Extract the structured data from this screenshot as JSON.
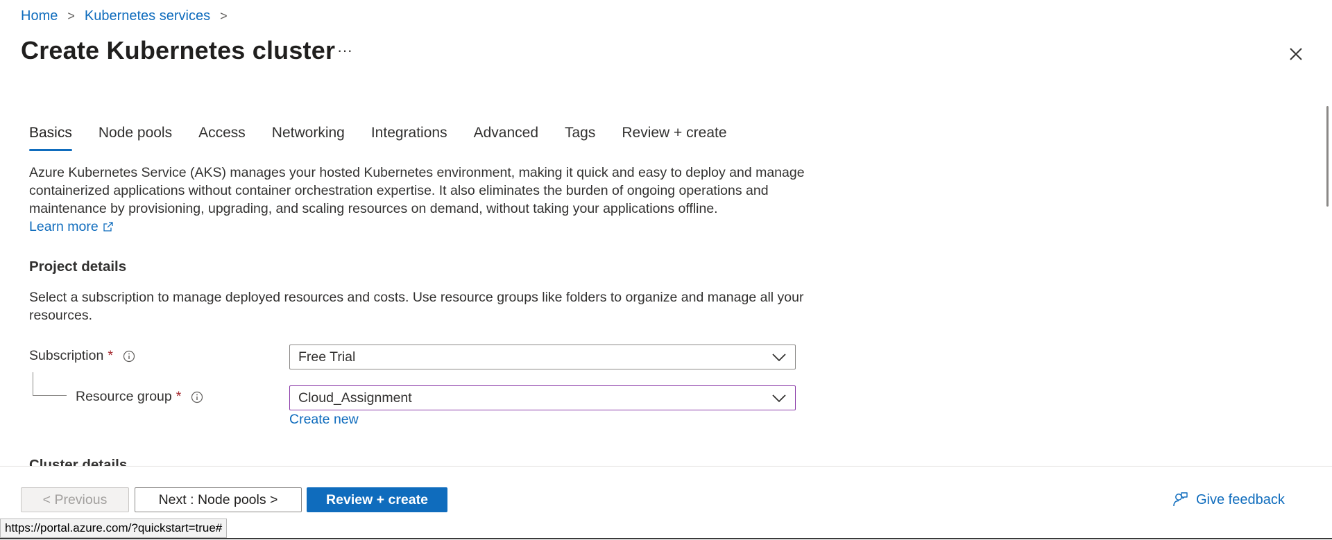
{
  "breadcrumb": {
    "items": [
      "Home",
      "Kubernetes services"
    ],
    "separator": ">"
  },
  "page": {
    "title": "Create Kubernetes cluster",
    "more_label": "···"
  },
  "tabs": [
    "Basics",
    "Node pools",
    "Access",
    "Networking",
    "Integrations",
    "Advanced",
    "Tags",
    "Review + create"
  ],
  "active_tab": "Basics",
  "intro": {
    "text": "Azure Kubernetes Service (AKS) manages your hosted Kubernetes environment, making it quick and easy to deploy and manage containerized applications without container orchestration expertise. It also eliminates the burden of ongoing operations and maintenance by provisioning, upgrading, and scaling resources on demand, without taking your applications offline.",
    "learn_more": "Learn more"
  },
  "project_details": {
    "heading": "Project details",
    "description": "Select a subscription to manage deployed resources and costs. Use resource groups like folders to organize and manage all your resources.",
    "subscription": {
      "label": "Subscription",
      "required_mark": "*",
      "value": "Free Trial"
    },
    "resource_group": {
      "label": "Resource group",
      "required_mark": "*",
      "value": "Cloud_Assignment",
      "create_new": "Create new"
    }
  },
  "cluster_details": {
    "heading": "Cluster details"
  },
  "footer": {
    "previous": "< Previous",
    "next": "Next : Node pools >",
    "review_create": "Review + create",
    "feedback": "Give feedback"
  },
  "status_bar": {
    "url": "https://portal.azure.com/?quickstart=true#"
  },
  "colors": {
    "accent": "#0f6cbd",
    "required": "#a4262c",
    "focus_border": "#8a3aa8"
  },
  "icons": [
    "chevron-right-icon",
    "more-icon",
    "close-icon",
    "external-link-icon",
    "info-icon",
    "chevron-down-icon",
    "feedback-icon"
  ]
}
